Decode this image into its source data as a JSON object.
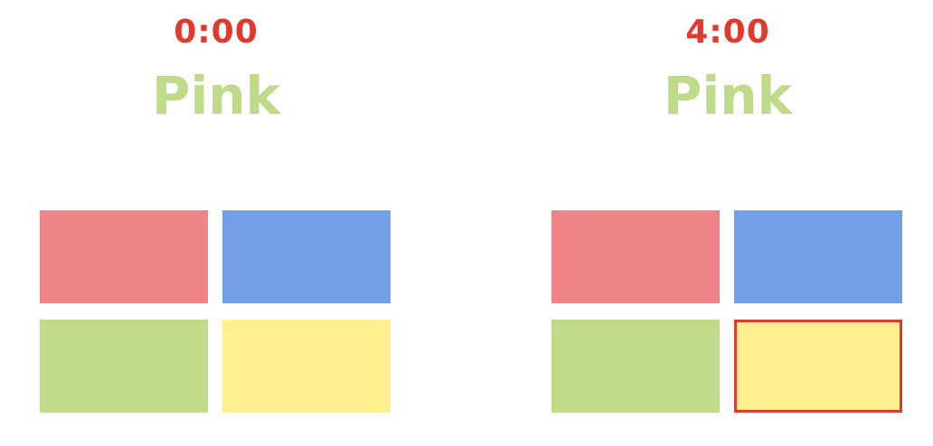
{
  "colors": {
    "timer": "#e03a2f",
    "word": "#bfdb8a",
    "pink": "#ef8387",
    "blue": "#729fe6",
    "green": "#c0dc8a",
    "yellow": "#ffef8e",
    "selection_border": "#e03a2f"
  },
  "panels": [
    {
      "timer": "0:00",
      "word": "Pink",
      "tiles": [
        "pink",
        "blue",
        "green",
        "yellow"
      ],
      "selected_tile": null
    },
    {
      "timer": "4:00",
      "word": "Pink",
      "tiles": [
        "pink",
        "blue",
        "green",
        "yellow"
      ],
      "selected_tile": "yellow"
    }
  ]
}
